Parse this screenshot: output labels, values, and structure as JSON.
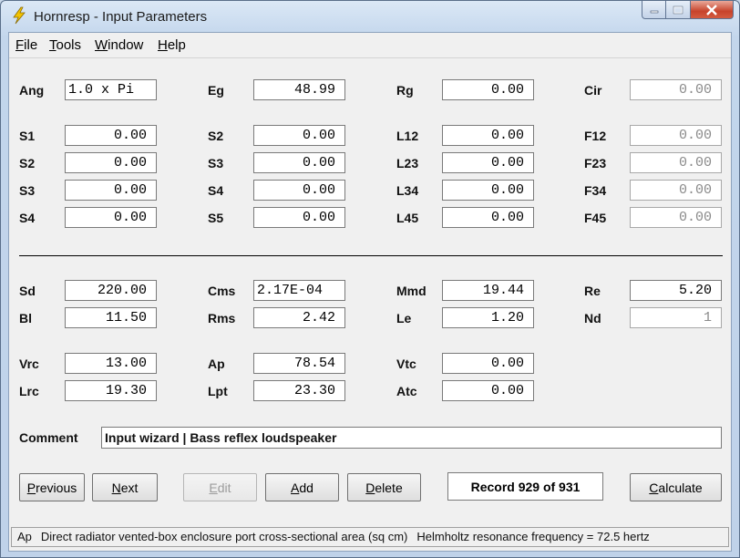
{
  "window": {
    "title": "Hornresp - Input Parameters",
    "app_icon": "lightning-bolt-icon"
  },
  "menu": [
    {
      "label": "File",
      "mnemonic": "F"
    },
    {
      "label": "Tools",
      "mnemonic": "T"
    },
    {
      "label": "Window",
      "mnemonic": "W"
    },
    {
      "label": "Help",
      "mnemonic": "H"
    }
  ],
  "rows": {
    "r1": [
      {
        "label": "Ang",
        "value": "1.0 x Pi",
        "align": "left",
        "disabled": false
      },
      {
        "label": "Eg",
        "value": "48.99",
        "disabled": false
      },
      {
        "label": "Rg",
        "value": "0.00",
        "disabled": false
      },
      {
        "label": "Cir",
        "value": "0.00",
        "disabled": true
      }
    ],
    "r2": [
      {
        "label": "S1",
        "value": "0.00",
        "disabled": false
      },
      {
        "label": "S2",
        "value": "0.00",
        "disabled": false
      },
      {
        "label": "L12",
        "value": "0.00",
        "disabled": false
      },
      {
        "label": "F12",
        "value": "0.00",
        "disabled": true
      }
    ],
    "r3": [
      {
        "label": "S2",
        "value": "0.00",
        "disabled": false
      },
      {
        "label": "S3",
        "value": "0.00",
        "disabled": false
      },
      {
        "label": "L23",
        "value": "0.00",
        "disabled": false
      },
      {
        "label": "F23",
        "value": "0.00",
        "disabled": true
      }
    ],
    "r4": [
      {
        "label": "S3",
        "value": "0.00",
        "disabled": false
      },
      {
        "label": "S4",
        "value": "0.00",
        "disabled": false
      },
      {
        "label": "L34",
        "value": "0.00",
        "disabled": false
      },
      {
        "label": "F34",
        "value": "0.00",
        "disabled": true
      }
    ],
    "r5": [
      {
        "label": "S4",
        "value": "0.00",
        "disabled": false
      },
      {
        "label": "S5",
        "value": "0.00",
        "disabled": false
      },
      {
        "label": "L45",
        "value": "0.00",
        "disabled": false
      },
      {
        "label": "F45",
        "value": "0.00",
        "disabled": true
      }
    ],
    "r6": [
      {
        "label": "Sd",
        "value": "220.00",
        "disabled": false
      },
      {
        "label": "Cms",
        "value": "2.17E-04",
        "align": "left",
        "disabled": false
      },
      {
        "label": "Mmd",
        "value": "19.44",
        "disabled": false
      },
      {
        "label": "Re",
        "value": "5.20",
        "disabled": false
      }
    ],
    "r7": [
      {
        "label": "Bl",
        "value": "11.50",
        "disabled": false
      },
      {
        "label": "Rms",
        "value": "2.42",
        "disabled": false
      },
      {
        "label": "Le",
        "value": "1.20",
        "disabled": false
      },
      {
        "label": "Nd",
        "value": "1",
        "disabled": true
      }
    ],
    "r8": [
      {
        "label": "Vrc",
        "value": "13.00",
        "disabled": false
      },
      {
        "label": "Ap",
        "value": "78.54",
        "disabled": false
      },
      {
        "label": "Vtc",
        "value": "0.00",
        "disabled": false
      }
    ],
    "r9": [
      {
        "label": "Lrc",
        "value": "19.30",
        "disabled": false
      },
      {
        "label": "Lpt",
        "value": "23.30",
        "disabled": false
      },
      {
        "label": "Atc",
        "value": "0.00",
        "disabled": false
      }
    ]
  },
  "comment": {
    "label": "Comment",
    "value": "Input wizard | Bass reflex loudspeaker"
  },
  "buttons": {
    "previous": {
      "label": "Previous",
      "enabled": true
    },
    "next": {
      "label": "Next",
      "enabled": true
    },
    "edit": {
      "label": "Edit",
      "enabled": false
    },
    "add": {
      "label": "Add",
      "enabled": true
    },
    "delete": {
      "label": "Delete",
      "enabled": true
    },
    "calculate": {
      "label": "Calculate",
      "enabled": true
    }
  },
  "record": "Record 929 of 931",
  "status": {
    "field": "Ap",
    "description": "Direct radiator vented-box enclosure port cross-sectional area  (sq cm)",
    "extra": "Helmholtz resonance frequency = 72.5 hertz"
  }
}
